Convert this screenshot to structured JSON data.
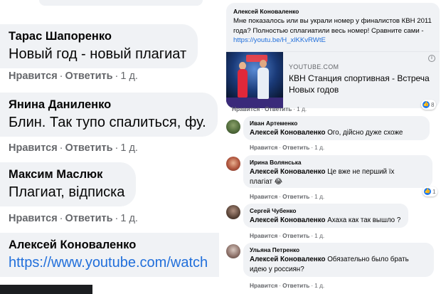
{
  "left_panel": {
    "comments": [
      {
        "author": "Тарас Шапоренко",
        "text": "Новый год - новый плагиат",
        "like": "Нравится",
        "reply": "Ответить",
        "time": "1 д."
      },
      {
        "author": "Янина Даниленко",
        "text": "Блин. Так тупо спалиться, фу.",
        "like": "Нравится",
        "reply": "Ответить",
        "time": "1 д."
      },
      {
        "author": "Максим Маслюк",
        "text": "Плагиат, відписка",
        "like": "Нравится",
        "reply": "Ответить",
        "time": "1 д."
      },
      {
        "author": "Алексей Коноваленко",
        "text": "https://www.youtube.com/watch"
      }
    ],
    "separator": "·"
  },
  "right_panel": {
    "post": {
      "author": "Алексей Коноваленко",
      "text_main": "Мне показалось или вы украли номер у финалистов КВН 2011 года? Полностью сплагиатили весь номер! Сравните сами - ",
      "link": "https://youtu.be/H_xlKKvRWtE",
      "preview": {
        "domain": "YOUTUBE.COM",
        "title": "КВН Станция спортивная - Встреча Новых годов",
        "info_icon": "i"
      },
      "like": "Нравится",
      "reply": "Ответить",
      "time": "1 д.",
      "reactions": "8"
    },
    "replies": [
      {
        "author": "Иван Артеменко",
        "mention": "Алексей Коноваленко",
        "text": " Ого, дійсно дуже схоже",
        "like": "Нравится",
        "reply": "Ответить",
        "time": "1 д."
      },
      {
        "author": "Ирина Волянська",
        "mention": "Алексей Коноваленко",
        "text_line1": " Це вже не перший їх",
        "text_line2": "плагіат ",
        "emoji": "😂",
        "like": "Нравится",
        "reply": "Ответить",
        "time": "1 д.",
        "reactions": "1"
      },
      {
        "author": "Сергей Чубенко",
        "mention": "Алексей Коноваленко",
        "text": " Ахаха как так вышло ?",
        "like": "Нравится",
        "reply": "Ответить",
        "time": "1 д."
      },
      {
        "author": "Ульяна Петренко",
        "mention": "Алексей Коноваленко",
        "text_line1": " Обязательно было брать",
        "text_line2": "идею у россиян?",
        "like": "Нравится",
        "reply": "Ответить",
        "time": "1 д."
      }
    ],
    "separator": "·",
    "like_icon": "👍"
  },
  "colors": {
    "bubble": "#f0f2f5",
    "link": "#216fdb",
    "meta": "#65676b",
    "like_blue": "#1877f2"
  }
}
